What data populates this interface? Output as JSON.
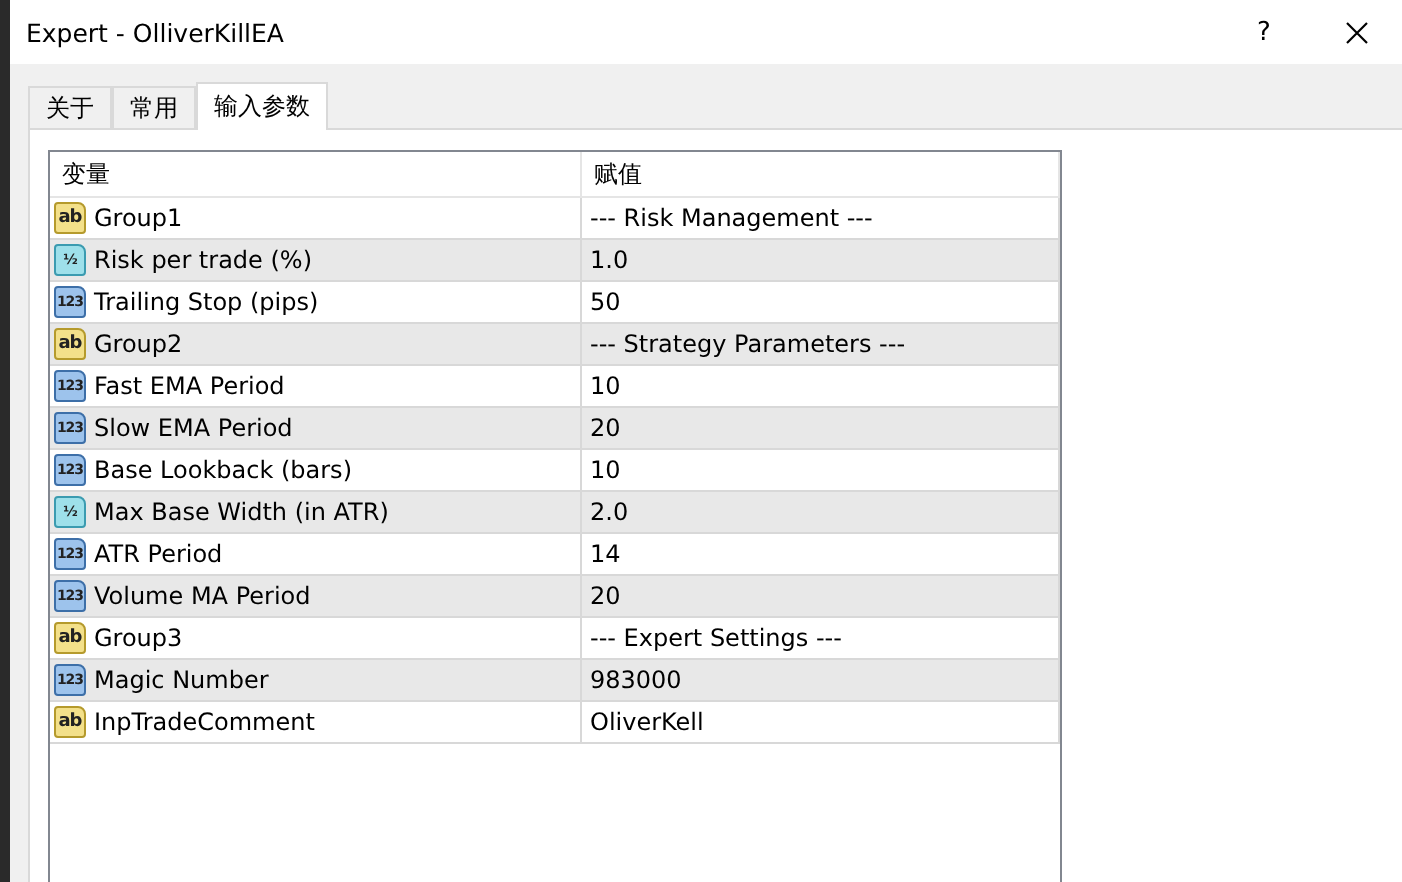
{
  "window": {
    "title": "Expert - OlliverKillEA",
    "help": "?"
  },
  "tabs": [
    {
      "label": "关于",
      "selected": false
    },
    {
      "label": "常用",
      "selected": false
    },
    {
      "label": "输入参数",
      "selected": true
    }
  ],
  "table": {
    "columns": [
      "变量",
      "赋值"
    ],
    "rows": [
      {
        "kind": "string",
        "type_label": "ab",
        "name": "Group1",
        "value": "--- Risk Management ---"
      },
      {
        "kind": "double",
        "type_label": "½",
        "name": "Risk per trade (%)",
        "value": "1.0"
      },
      {
        "kind": "int",
        "type_label": "123",
        "name": "Trailing Stop (pips)",
        "value": "50"
      },
      {
        "kind": "string",
        "type_label": "ab",
        "name": "Group2",
        "value": "--- Strategy Parameters ---"
      },
      {
        "kind": "int",
        "type_label": "123",
        "name": "Fast EMA Period",
        "value": "10"
      },
      {
        "kind": "int",
        "type_label": "123",
        "name": "Slow EMA Period",
        "value": "20"
      },
      {
        "kind": "int",
        "type_label": "123",
        "name": "Base Lookback (bars)",
        "value": "10"
      },
      {
        "kind": "double",
        "type_label": "½",
        "name": "Max Base Width (in ATR)",
        "value": "2.0"
      },
      {
        "kind": "int",
        "type_label": "123",
        "name": "ATR Period",
        "value": "14"
      },
      {
        "kind": "int",
        "type_label": "123",
        "name": "Volume MA Period",
        "value": "20"
      },
      {
        "kind": "string",
        "type_label": "ab",
        "name": "Group3",
        "value": "--- Expert Settings ---"
      },
      {
        "kind": "int",
        "type_label": "123",
        "name": "Magic Number",
        "value": "983000"
      },
      {
        "kind": "string",
        "type_label": "ab",
        "name": "InpTradeComment",
        "value": "OliverKell"
      }
    ]
  }
}
